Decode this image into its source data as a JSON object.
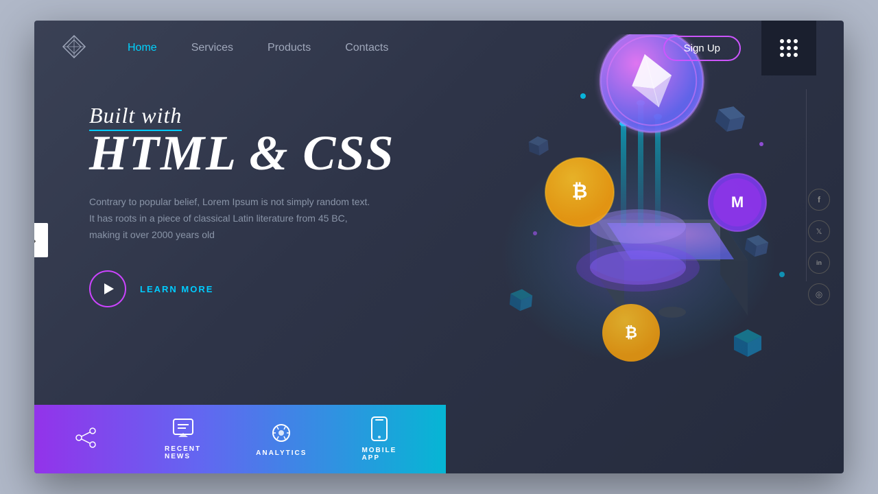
{
  "navbar": {
    "logo_label": "diamond-logo",
    "links": [
      {
        "label": "Home",
        "active": true
      },
      {
        "label": "Services",
        "active": false
      },
      {
        "label": "Products",
        "active": false
      },
      {
        "label": "Contacts",
        "active": false
      }
    ],
    "signup_label": "Sign Up",
    "grid_button_label": "menu-grid"
  },
  "hero": {
    "subtitle": "Built with",
    "title": "HTML & CSS",
    "description": "Contrary to popular belief, Lorem Ipsum is not simply random text. It has roots in a piece of classical Latin literature from 45 BC, making it over 2000 years old",
    "cta_label": "LEARN MORE"
  },
  "bottom_bar": {
    "items": [
      {
        "label": "RECENT NEWS",
        "icon": "chat-icon"
      },
      {
        "label": "ANALYTICS",
        "icon": "gear-icon"
      },
      {
        "label": "MOBILE APP",
        "icon": "mobile-icon"
      }
    ]
  },
  "social": {
    "icons": [
      {
        "label": "facebook-icon",
        "char": "f"
      },
      {
        "label": "twitter-icon",
        "char": "t"
      },
      {
        "label": "linkedin-icon",
        "char": "in"
      },
      {
        "label": "instagram-icon",
        "char": "ig"
      }
    ]
  },
  "colors": {
    "accent_cyan": "#00d4ff",
    "accent_purple": "#cc44ff",
    "bg_dark": "#2e3448",
    "text_muted": "#8a95a8"
  }
}
